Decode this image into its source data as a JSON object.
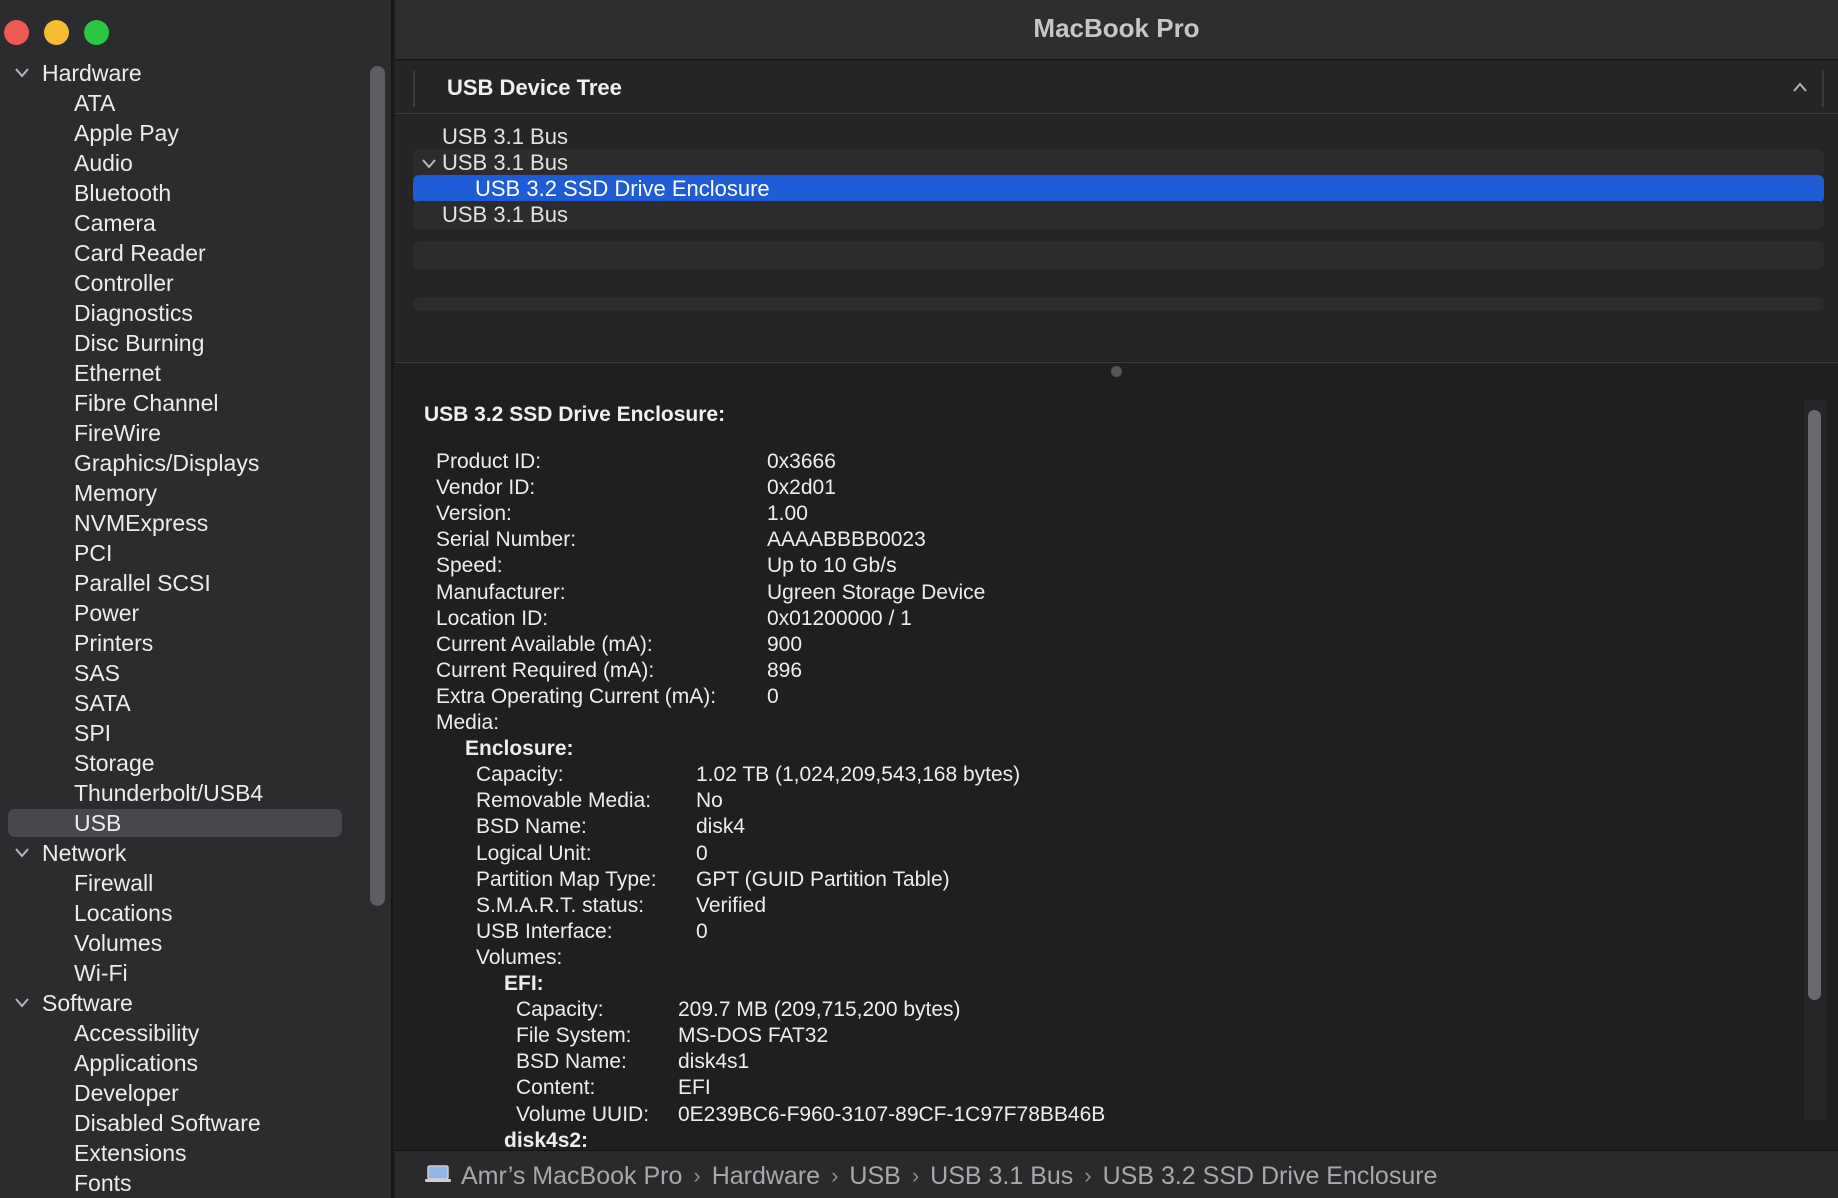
{
  "window": {
    "title": "MacBook Pro"
  },
  "sidebar": {
    "sections": [
      {
        "title": "Hardware",
        "items": [
          "ATA",
          "Apple Pay",
          "Audio",
          "Bluetooth",
          "Camera",
          "Card Reader",
          "Controller",
          "Diagnostics",
          "Disc Burning",
          "Ethernet",
          "Fibre Channel",
          "FireWire",
          "Graphics/Displays",
          "Memory",
          "NVMExpress",
          "PCI",
          "Parallel SCSI",
          "Power",
          "Printers",
          "SAS",
          "SATA",
          "SPI",
          "Storage",
          "Thunderbolt/USB4",
          "USB"
        ]
      },
      {
        "title": "Network",
        "items": [
          "Firewall",
          "Locations",
          "Volumes",
          "Wi-Fi"
        ]
      },
      {
        "title": "Software",
        "items": [
          "Accessibility",
          "Applications",
          "Developer",
          "Disabled Software",
          "Extensions",
          "Fonts"
        ]
      }
    ],
    "selected": "USB"
  },
  "device_tree": {
    "header": "USB Device Tree",
    "rows": [
      {
        "label": "USB 3.1 Bus"
      },
      {
        "label": "USB 3.1 Bus"
      },
      {
        "label": "USB 3.2 SSD Drive Enclosure"
      },
      {
        "label": "USB 3.1 Bus"
      }
    ]
  },
  "detail": {
    "title": "USB 3.2 SSD Drive Enclosure:",
    "props": [
      {
        "k": "Product ID:",
        "v": "0x3666"
      },
      {
        "k": "Vendor ID:",
        "v": "0x2d01"
      },
      {
        "k": "Version:",
        "v": "1.00"
      },
      {
        "k": "Serial Number:",
        "v": "AAAABBBB0023"
      },
      {
        "k": "Speed:",
        "v": "Up to 10 Gb/s"
      },
      {
        "k": "Manufacturer:",
        "v": "Ugreen Storage Device"
      },
      {
        "k": "Location ID:",
        "v": "0x01200000 / 1"
      },
      {
        "k": "Current Available (mA):",
        "v": "900"
      },
      {
        "k": "Current Required (mA):",
        "v": "896"
      },
      {
        "k": "Extra Operating Current (mA):",
        "v": "0"
      }
    ],
    "media_label": "Media:",
    "enclosure_label": "Enclosure:",
    "enclosure": [
      {
        "k": "Capacity:",
        "v": "1.02 TB (1,024,209,543,168 bytes)"
      },
      {
        "k": "Removable Media:",
        "v": "No"
      },
      {
        "k": "BSD Name:",
        "v": "disk4"
      },
      {
        "k": "Logical Unit:",
        "v": "0"
      },
      {
        "k": "Partition Map Type:",
        "v": "GPT (GUID Partition Table)"
      },
      {
        "k": "S.M.A.R.T. status:",
        "v": "Verified"
      },
      {
        "k": "USB Interface:",
        "v": "0"
      }
    ],
    "volumes_label": "Volumes:",
    "efi_label": "EFI:",
    "efi": [
      {
        "k": "Capacity:",
        "v": "209.7 MB (209,715,200 bytes)"
      },
      {
        "k": "File System:",
        "v": "MS-DOS FAT32"
      },
      {
        "k": "BSD Name:",
        "v": "disk4s1"
      },
      {
        "k": "Content:",
        "v": "EFI"
      },
      {
        "k": "Volume UUID:",
        "v": "0E239BC6-F960-3107-89CF-1C97F78BB46B"
      }
    ],
    "next_volume_label": "disk4s2:"
  },
  "pathbar": {
    "icon": "laptop-icon",
    "crumbs": [
      "Amr’s MacBook Pro",
      "Hardware",
      "USB",
      "USB 3.1 Bus",
      "USB 3.2 SSD Drive Enclosure"
    ],
    "separator": "›"
  },
  "colors": {
    "selection_blue": "#1e5bd6",
    "sidebar_selection": "#48474b",
    "traffic_close": "#ee5a52",
    "traffic_minimize": "#f5bd2f",
    "traffic_zoom": "#29c840"
  }
}
